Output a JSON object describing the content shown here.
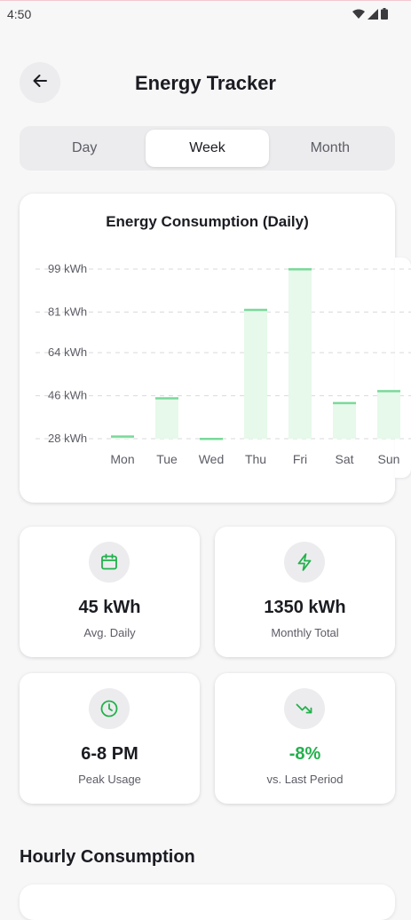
{
  "status_bar": {
    "time": "4:50",
    "icons": [
      "wifi-icon",
      "signal-icon",
      "battery-icon"
    ]
  },
  "header": {
    "back_icon": "arrow-left-icon",
    "title": "Energy Tracker"
  },
  "tabs": [
    {
      "label": "Day",
      "active": false
    },
    {
      "label": "Week",
      "active": true
    },
    {
      "label": "Month",
      "active": false
    }
  ],
  "chart": {
    "title": "Energy Consumption (Daily)"
  },
  "chart_data": {
    "type": "bar",
    "title": "Energy Consumption (Daily)",
    "categories": [
      "Mon",
      "Tue",
      "Wed",
      "Thu",
      "Fri",
      "Sat",
      "Sun"
    ],
    "values": [
      29,
      45,
      28,
      82,
      99,
      43,
      48
    ],
    "y_ticks": [
      "99 kWh",
      "81 kWh",
      "64 kWh",
      "46 kWh",
      "28 kWh"
    ],
    "y_tick_values": [
      99,
      81,
      64,
      46,
      28
    ],
    "ylim": [
      28,
      99
    ],
    "grid": "dashed horizontal",
    "colors": {
      "bar_fill": "#e6f9ea",
      "bar_top": "#7ad99a",
      "grid": "#d9d9dd"
    }
  },
  "stats": [
    {
      "icon": "calendar-icon",
      "value": "45 kWh",
      "label": "Avg. Daily"
    },
    {
      "icon": "lightning-icon",
      "value": "1350 kWh",
      "label": "Monthly Total"
    },
    {
      "icon": "clock-icon",
      "value": "6-8 PM",
      "label": "Peak Usage"
    },
    {
      "icon": "trending-down-icon",
      "value": "-8%",
      "label": "vs. Last Period"
    }
  ],
  "section": {
    "hourly_title": "Hourly Consumption"
  },
  "colors": {
    "accent": "#22b14c",
    "background": "#f7f7f8",
    "card": "#ffffff"
  }
}
